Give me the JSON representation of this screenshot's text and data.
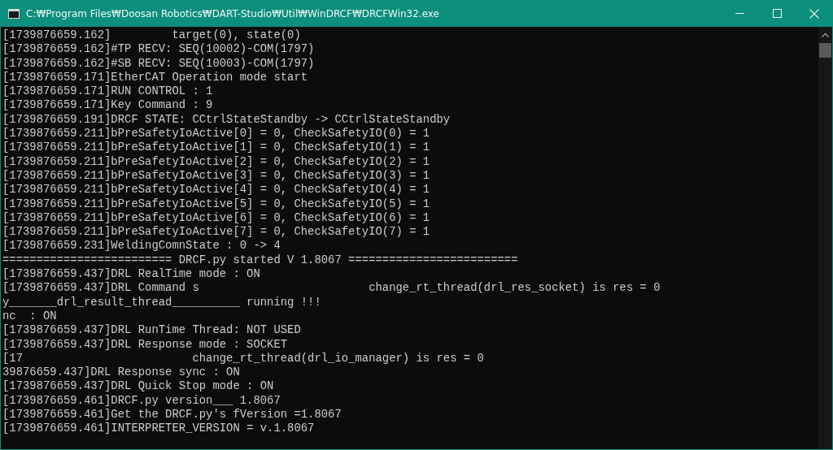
{
  "window": {
    "title": "C:₩Program Files₩Doosan Robotics₩DART-Studio₩Util₩WinDRCF₩DRCFWin32.exe"
  },
  "console": {
    "lines": [
      "[1739876659.162]         target(0), state(0)",
      "[1739876659.162]#TP RECV: SEQ(10002)-COM(1797)",
      "[1739876659.162]#SB RECV: SEQ(10003)-COM(1797)",
      "[1739876659.171]EtherCAT Operation mode start",
      "[1739876659.171]RUN CONTROL : 1",
      "[1739876659.171]Key Command : 9",
      "[1739876659.191]DRCF STATE: CCtrlStateStandby -> CCtrlStateStandby",
      "[1739876659.211]bPreSafetyIoActive[0] = 0, CheckSafetyIO(0) = 1",
      "[1739876659.211]bPreSafetyIoActive[1] = 0, CheckSafetyIO(1) = 1",
      "[1739876659.211]bPreSafetyIoActive[2] = 0, CheckSafetyIO(2) = 1",
      "[1739876659.211]bPreSafetyIoActive[3] = 0, CheckSafetyIO(3) = 1",
      "[1739876659.211]bPreSafetyIoActive[4] = 0, CheckSafetyIO(4) = 1",
      "[1739876659.211]bPreSafetyIoActive[5] = 0, CheckSafetyIO(5) = 1",
      "[1739876659.211]bPreSafetyIoActive[6] = 0, CheckSafetyIO(6) = 1",
      "[1739876659.211]bPreSafetyIoActive[7] = 0, CheckSafetyIO(7) = 1",
      "[1739876659.231]WeldingComnState : 0 -> 4",
      "========================= DRCF.py started V 1.8067 =========================",
      "[1739876659.437]DRL RealTime mode : ON",
      "[1739876659.437]DRL Command s                         change_rt_thread(drl_res_socket) is res = 0",
      "y_______drl_result_thread__________ running !!!",
      "nc  : ON",
      "[1739876659.437]DRL RunTime Thread: NOT USED",
      "[1739876659.437]DRL Response mode : SOCKET",
      "[17                         change_rt_thread(drl_io_manager) is res = 0",
      "39876659.437]DRL Response sync : ON",
      "[1739876659.437]DRL Quick Stop mode : ON",
      "[1739876659.461]DRCF.py version___ 1.8067",
      "[1739876659.461]Get the DRCF.py's fVersion =1.8067",
      "[1739876659.461]INTERPRETER_VERSION = v.1.8067"
    ]
  }
}
